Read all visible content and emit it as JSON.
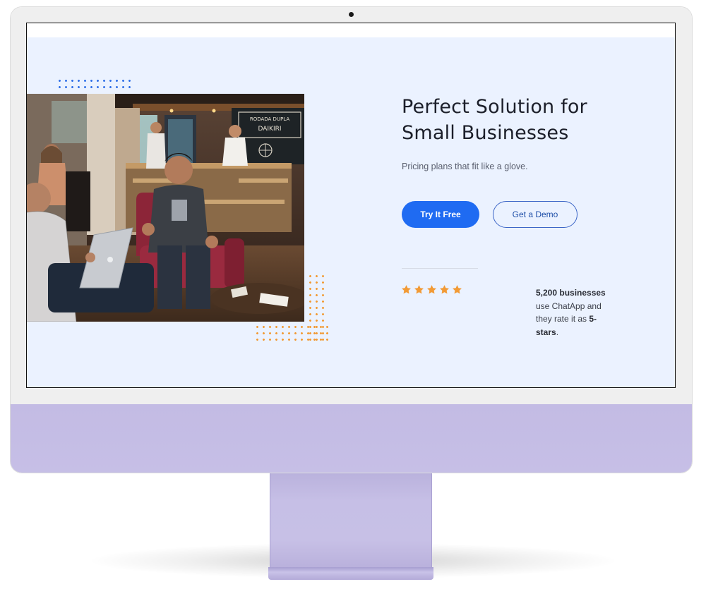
{
  "hero": {
    "title_line1": "Perfect Solution for",
    "title_line2": "Small Businesses",
    "subtitle": "Pricing plans that fit like a glove.",
    "primary_button": "Try It Free",
    "secondary_button": "Get a Demo"
  },
  "rating": {
    "stars": 5,
    "count_text": "5,200 businesses",
    "middle_text": " use ChatApp and they rate it as ",
    "bold_end": "5-stars",
    "period": "."
  },
  "photo": {
    "chalkboard_line1": "RODADA DUPLA",
    "chalkboard_line2": "DAIKIRI"
  },
  "colors": {
    "accent": "#1f6bf2",
    "hero_background": "#ebf2ff",
    "star": "#f29a35",
    "chin": "#c6bfe6"
  }
}
